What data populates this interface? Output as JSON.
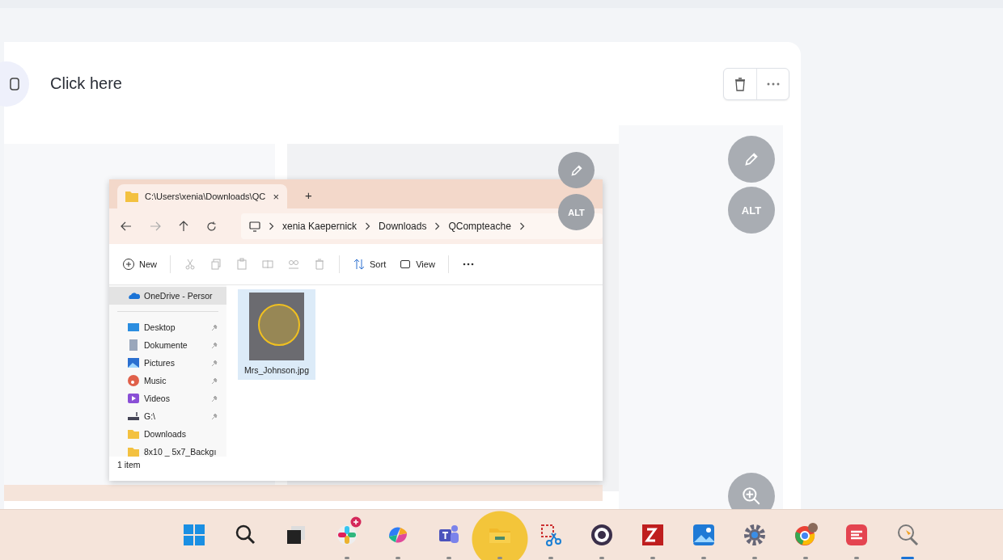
{
  "step": {
    "title": "Click here"
  },
  "screenshot": {
    "overlay_alt": "ALT",
    "explorer": {
      "tab_title": "C:\\Users\\xenia\\Downloads\\QC",
      "tab_close": "×",
      "new_tab": "+",
      "breadcrumb": [
        "xenia Kaepernick",
        "Downloads",
        "QCompteache"
      ],
      "toolbar": [
        {
          "kind": "new",
          "label": "New",
          "disabled": false
        },
        {
          "kind": "cut",
          "disabled": true
        },
        {
          "kind": "copy",
          "disabled": true
        },
        {
          "kind": "paste",
          "disabled": true
        },
        {
          "kind": "rename",
          "disabled": true
        },
        {
          "kind": "share",
          "disabled": true
        },
        {
          "kind": "delete",
          "disabled": true
        },
        {
          "kind": "sort",
          "label": "Sort",
          "disabled": false
        },
        {
          "kind": "view",
          "label": "View",
          "disabled": false
        },
        {
          "kind": "more",
          "disabled": false
        }
      ],
      "sidebar": [
        {
          "kind": "cloud",
          "label": "OneDrive - Persor",
          "pinned": false,
          "selected": true
        },
        {
          "kind": "desktop",
          "label": "Desktop",
          "pinned": true,
          "selected": false
        },
        {
          "kind": "documents",
          "label": "Dokumente",
          "pinned": true,
          "selected": false
        },
        {
          "kind": "pictures",
          "label": "Pictures",
          "pinned": true,
          "selected": false
        },
        {
          "kind": "music",
          "label": "Music",
          "pinned": true,
          "selected": false
        },
        {
          "kind": "videos",
          "label": "Videos",
          "pinned": true,
          "selected": false
        },
        {
          "kind": "drive",
          "label": "G:\\",
          "pinned": true,
          "selected": false
        },
        {
          "kind": "folder",
          "label": "Downloads",
          "pinned": false,
          "selected": false
        },
        {
          "kind": "folder",
          "label": "8x10 _ 5x7_Backgı",
          "pinned": false,
          "selected": false
        }
      ],
      "files": [
        {
          "name": "Mrs_Johnson.jpg",
          "selected": true,
          "highlighted": true
        }
      ],
      "status": "1 item"
    }
  },
  "side_panel": {
    "alt_label": "ALT"
  },
  "taskbar": [
    {
      "kind": "start",
      "running": false,
      "selected": false,
      "badge": false,
      "highlighted": false
    },
    {
      "kind": "search",
      "running": false,
      "selected": false,
      "badge": false,
      "highlighted": false
    },
    {
      "kind": "taskview",
      "running": false,
      "selected": false,
      "badge": false,
      "highlighted": false
    },
    {
      "kind": "pinwheel",
      "running": true,
      "selected": false,
      "badge": true,
      "highlighted": false
    },
    {
      "kind": "swirl",
      "running": true,
      "selected": false,
      "badge": false,
      "highlighted": false
    },
    {
      "kind": "people",
      "running": true,
      "selected": false,
      "badge": false,
      "highlighted": false
    },
    {
      "kind": "folder",
      "running": true,
      "selected": false,
      "badge": false,
      "highlighted": true
    },
    {
      "kind": "scissors",
      "running": true,
      "selected": false,
      "badge": false,
      "highlighted": false
    },
    {
      "kind": "eye",
      "running": true,
      "selected": false,
      "badge": false,
      "highlighted": false
    },
    {
      "kind": "zigzag",
      "running": true,
      "selected": false,
      "badge": false,
      "highlighted": false
    },
    {
      "kind": "landscape",
      "running": true,
      "selected": false,
      "badge": false,
      "highlighted": false
    },
    {
      "kind": "gear",
      "running": true,
      "selected": false,
      "badge": false,
      "highlighted": false
    },
    {
      "kind": "browser",
      "running": true,
      "selected": false,
      "badge": false,
      "highlighted": false
    },
    {
      "kind": "stripes",
      "running": true,
      "selected": false,
      "badge": false,
      "highlighted": false
    },
    {
      "kind": "magnifier",
      "running": true,
      "selected": true,
      "badge": false,
      "highlighted": false
    }
  ]
}
